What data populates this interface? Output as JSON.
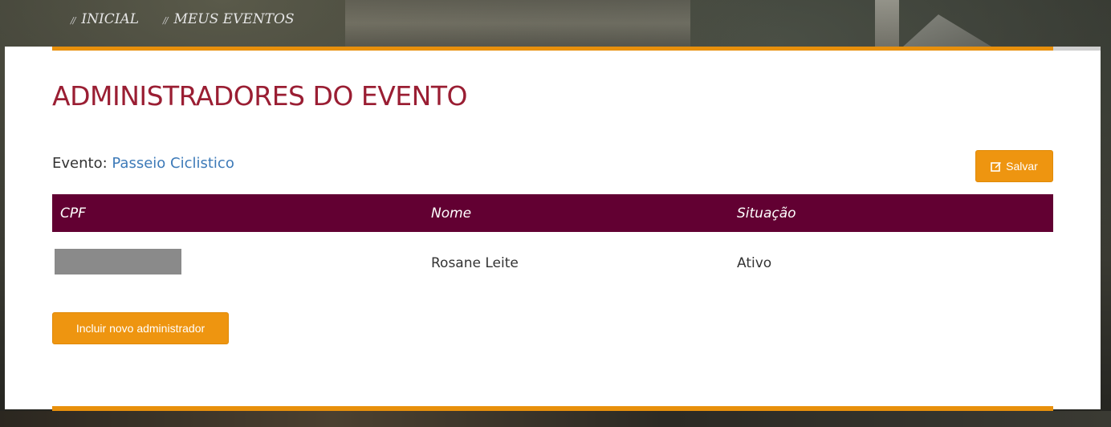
{
  "breadcrumb": [
    {
      "label": "INICIAL"
    },
    {
      "label": "MEUS EVENTOS"
    }
  ],
  "breadcrumb_separator": "//",
  "page": {
    "title": "ADMINISTRADORES DO EVENTO",
    "event_label": "Evento:",
    "event_name": "Passeio Ciclistico"
  },
  "buttons": {
    "save": "Salvar",
    "add_admin": "Incluir novo administrador"
  },
  "table": {
    "columns": [
      "CPF",
      "Nome",
      "Situação"
    ],
    "rows": [
      {
        "cpf": "",
        "nome": "Rosane Leite",
        "situacao": "Ativo"
      }
    ]
  },
  "colors": {
    "accent": "#ee9510",
    "title": "#9a1e33",
    "table_header": "#620032",
    "link": "#3d7ab8"
  },
  "icons": {
    "save": "edit-square-icon"
  }
}
